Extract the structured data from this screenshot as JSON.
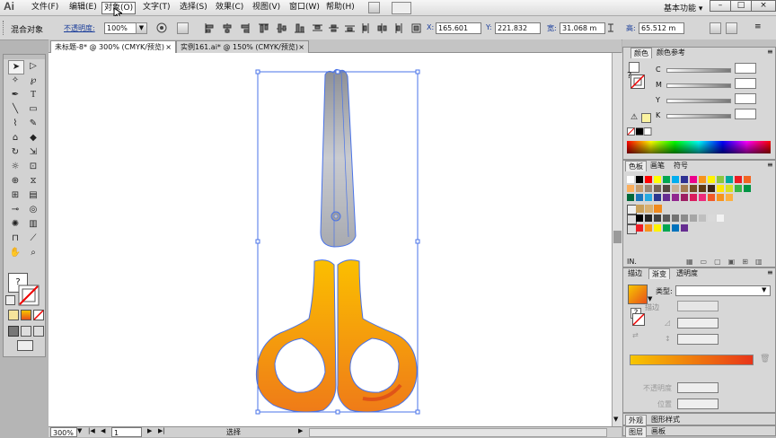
{
  "app": {
    "logo": "Ai",
    "workspace": "基本功能",
    "workspace_arrow": "▾"
  },
  "menu": {
    "items": [
      "文件(F)",
      "编辑(E)",
      "对象(O)",
      "文字(T)",
      "选择(S)",
      "效果(C)",
      "视图(V)",
      "窗口(W)",
      "帮助(H)"
    ]
  },
  "control": {
    "selection_label": "混合对象",
    "opacity_label": "不透明度:",
    "opacity_value": "100%",
    "x_label": "X:",
    "x_value": "165.601",
    "y_label": "Y:",
    "y_value": "221.832",
    "w_label": "宽:",
    "w_value": "31.068 m",
    "h_label": "高:",
    "h_value": "65.512 m"
  },
  "tabs": [
    {
      "label": "未标题-8* @ 300% (CMYK/预览)",
      "close": "×"
    },
    {
      "label": "实例161.ai* @ 150% (CMYK/预览)",
      "close": "×"
    }
  ],
  "status": {
    "zoom": "300%",
    "page": "1",
    "mode": "选择"
  },
  "color_panel": {
    "tabs": [
      "颜色",
      "颜色参考"
    ],
    "channels": [
      "C",
      "M",
      "Y",
      "K"
    ],
    "unknown_glyph": "?"
  },
  "swatches_panel": {
    "tabs": [
      "色板",
      "画笔",
      "符号"
    ],
    "colors": [
      "#ffffff",
      "#000000",
      "#ff0000",
      "#ffff00",
      "#00a651",
      "#00aeef",
      "#2e3192",
      "#ec008c",
      "#f7941d",
      "#fff200",
      "#8dc63f",
      "#00a99d",
      "#ed1c24",
      "#f26522",
      "#fbaf5d",
      "#c69c6d",
      "#998675",
      "#736357",
      "#534741",
      "#c7b299",
      "#a67c52",
      "#754c24",
      "#603913",
      "#3c2415",
      "#ffe600",
      "#d7df23",
      "#39b54a",
      "#009444",
      "#006838",
      "#1b75bb",
      "#27aae1",
      "#2b388f",
      "#662d91",
      "#92278f",
      "#9e1f63",
      "#da1c5c",
      "#ee2a7b",
      "#f15a29",
      "#f7941d",
      "#fbb040"
    ],
    "grays": [
      "#000000",
      "#242424",
      "#404040",
      "#5a5a5a",
      "#737373",
      "#8c8c8c",
      "#a6a6a6",
      "#bfbfbf",
      "#d9d9d9",
      "#f2f2f2"
    ],
    "brights": [
      "#ed1c24",
      "#f7941d",
      "#fff200",
      "#00a651",
      "#0072bc",
      "#662d91"
    ],
    "lib_label": "IN."
  },
  "gradient_panel": {
    "tabs": [
      "描边",
      "渐变",
      "透明度"
    ],
    "type_label": "类型:",
    "stroke_label": "描边",
    "opacity_label": "不透明度",
    "position_label": "位置",
    "start_color": "#f7c600",
    "end_color": "#e8351a"
  },
  "bottom_panels": {
    "row1": [
      "外观",
      "图形样式"
    ],
    "row2": [
      "图层",
      "画板"
    ]
  },
  "scissors": {
    "blade_color": "#b7b9bf",
    "handle_top": "#f9b400",
    "handle_bottom": "#f07d17",
    "path_color": "#4a73e8"
  }
}
